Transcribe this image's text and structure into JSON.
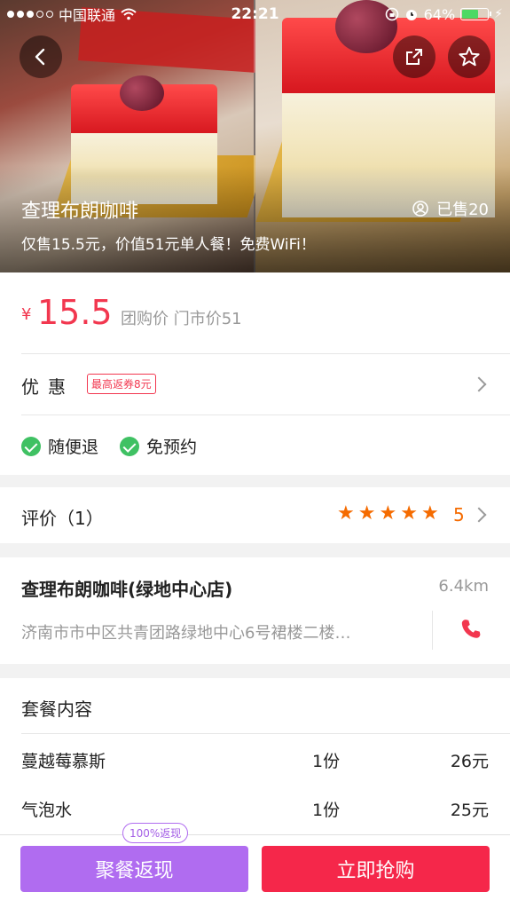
{
  "status_bar": {
    "carrier": "中国联通",
    "time": "22:21",
    "battery": "64%",
    "battery_level": 0.64
  },
  "hero": {
    "title": "查理布朗咖啡",
    "sold": "已售20",
    "subtitle": "仅售15.5元，价值51元单人餐！免费WiFi！",
    "back_icon": "back-arrow-icon",
    "share_icon": "share-icon",
    "favorite_icon": "star-outline-icon"
  },
  "price": {
    "currency": "¥",
    "value": "15.5",
    "label": "团购价 门市价51"
  },
  "discount": {
    "label": "优惠",
    "tag": "最高返券8元"
  },
  "perks": [
    "随便退",
    "免预约"
  ],
  "review": {
    "title": "评价（1）",
    "stars": 5,
    "score": "5"
  },
  "shop": {
    "name": "查理布朗咖啡(绿地中心店)",
    "distance": "6.4km",
    "address": "济南市市中区共青团路绿地中心6号裙楼二楼…"
  },
  "package": {
    "title": "套餐内容",
    "items": [
      {
        "name": "蔓越莓慕斯",
        "qty": "1份",
        "price": "26元"
      },
      {
        "name": "气泡水",
        "qty": "1份",
        "price": "25元"
      }
    ]
  },
  "bottom": {
    "bubble": "100%返现",
    "left_button": "聚餐返现",
    "right_button": "立即抢购"
  },
  "colors": {
    "accent_red": "#f2374f",
    "accent_purple": "#b06cf0",
    "star_orange": "#f56b00",
    "check_green": "#3fc163"
  }
}
